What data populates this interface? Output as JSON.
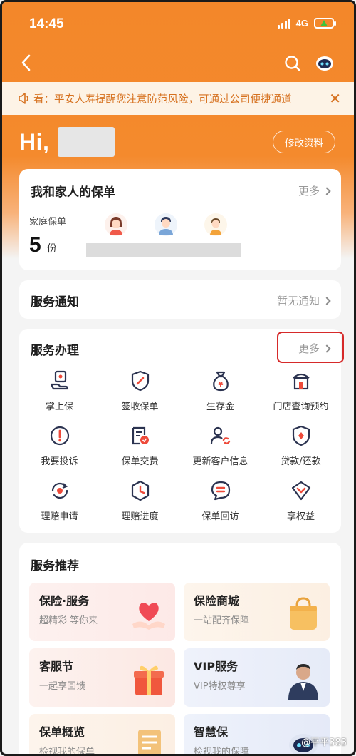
{
  "status": {
    "time": "14:45",
    "network": "4G"
  },
  "notice": {
    "text": "看：平安人寿提醒您注意防范风险，可通过公司便捷通道"
  },
  "header": {
    "greeting": "Hi,",
    "edit_profile": "修改资料"
  },
  "policies": {
    "title": "我和家人的保单",
    "more": "更多",
    "family_label": "家庭保单",
    "count": "5",
    "unit": "份"
  },
  "notifications": {
    "title": "服务通知",
    "status": "暂无通知"
  },
  "services": {
    "title": "服务办理",
    "more": "更多",
    "items": [
      {
        "label": "掌上保",
        "icon": "palm-policy-icon"
      },
      {
        "label": "签收保单",
        "icon": "sign-policy-icon"
      },
      {
        "label": "生存金",
        "icon": "money-bag-icon"
      },
      {
        "label": "门店查询预约",
        "icon": "store-icon"
      },
      {
        "label": "我要投诉",
        "icon": "complaint-icon"
      },
      {
        "label": "保单交费",
        "icon": "policy-payment-icon"
      },
      {
        "label": "更新客户信息",
        "icon": "update-user-icon"
      },
      {
        "label": "贷款/还款",
        "icon": "loan-icon"
      },
      {
        "label": "理赔申请",
        "icon": "claim-apply-icon"
      },
      {
        "label": "理赔进度",
        "icon": "claim-progress-icon"
      },
      {
        "label": "保单回访",
        "icon": "policy-revisit-icon"
      },
      {
        "label": "享权益",
        "icon": "benefits-icon"
      }
    ]
  },
  "recommend": {
    "title": "服务推荐",
    "tiles": [
      {
        "title": "保险·服务",
        "subtitle": "超精彩 等你来"
      },
      {
        "title": "保险商城",
        "subtitle": "一站配齐保障"
      },
      {
        "title": "客服节",
        "subtitle": "一起享回馈"
      },
      {
        "title": "VIP服务",
        "subtitle": "VIP特权尊享"
      },
      {
        "title": "保单概览",
        "subtitle": "检视我的保单"
      },
      {
        "title": "智慧保",
        "subtitle": "检视我的保障"
      }
    ]
  },
  "watermark": "@平平383",
  "colors": {
    "brand_orange": "#f3872a",
    "highlight_red": "#d62a2a",
    "notice_text": "#d6711f"
  }
}
